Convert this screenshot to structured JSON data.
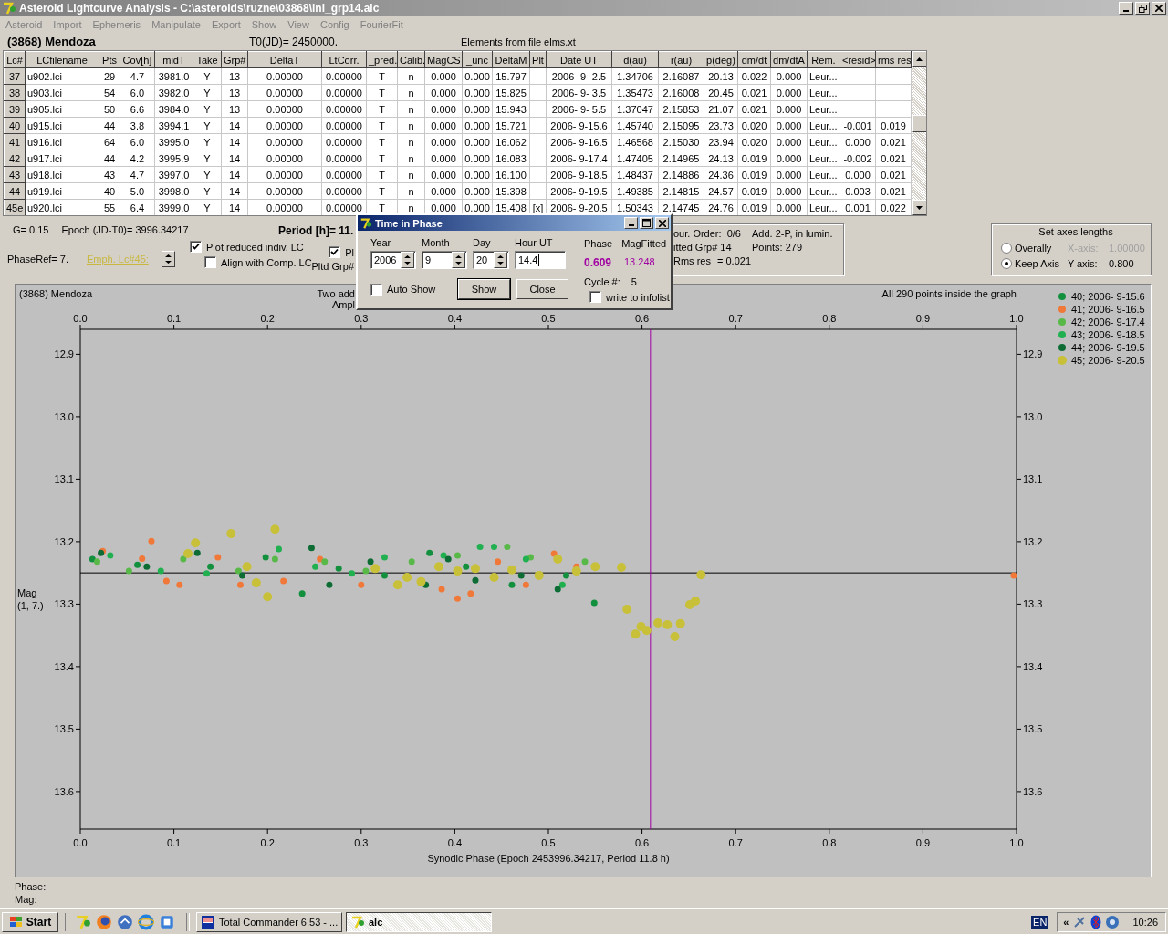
{
  "window": {
    "title": "Asteroid Lightcurve Analysis - C:\\asteroids\\ruzne\\03868\\ini_grp14.alc"
  },
  "menu": [
    {
      "label": "Asteroid",
      "disabled": true
    },
    {
      "label": "Import",
      "disabled": true
    },
    {
      "label": "Ephemeris",
      "disabled": true
    },
    {
      "label": "Manipulate",
      "disabled": true
    },
    {
      "label": "Export",
      "disabled": true
    },
    {
      "label": "Show",
      "disabled": true
    },
    {
      "label": "View",
      "disabled": true
    },
    {
      "label": "Config",
      "disabled": true
    },
    {
      "label": "FourierFit",
      "disabled": true
    }
  ],
  "header": {
    "asteroid": "(3868) Mendoza",
    "t0": "T0(JD)= 2450000.",
    "elements": "Elements from file elms.xt"
  },
  "table": {
    "columns": [
      "Lc#",
      "LCfilename",
      "Pts",
      "Cov[h]",
      "midT",
      "Take",
      "Grp#",
      "DeltaT",
      "LtCorr.",
      "_pred.",
      "Calib.",
      "MagCS",
      "_unc",
      "DeltaM",
      "Plt",
      "Date UT",
      "d(au)",
      "r(au)",
      "p(deg)",
      "dm/dt",
      "dm/dtA",
      "Rem.",
      "<resid>",
      "rms res"
    ],
    "rows": [
      {
        "cells": [
          "37",
          "u902.lci",
          "29",
          "4.7",
          "3981.0",
          "Y",
          "13",
          "0.00000",
          "0.00000",
          "T",
          "n",
          "0.000",
          "0.000",
          "15.797",
          "",
          "2006- 9- 2.5",
          "1.34706",
          "2.16087",
          "20.13",
          "0.022",
          "0.000",
          "Leur...",
          "",
          ""
        ]
      },
      {
        "cells": [
          "38",
          "u903.lci",
          "54",
          "6.0",
          "3982.0",
          "Y",
          "13",
          "0.00000",
          "0.00000",
          "T",
          "n",
          "0.000",
          "0.000",
          "15.825",
          "",
          "2006- 9- 3.5",
          "1.35473",
          "2.16008",
          "20.45",
          "0.021",
          "0.000",
          "Leur...",
          "",
          ""
        ]
      },
      {
        "cells": [
          "39",
          "u905.lci",
          "50",
          "6.6",
          "3984.0",
          "Y",
          "13",
          "0.00000",
          "0.00000",
          "T",
          "n",
          "0.000",
          "0.000",
          "15.943",
          "",
          "2006- 9- 5.5",
          "1.37047",
          "2.15853",
          "21.07",
          "0.021",
          "0.000",
          "Leur...",
          "",
          ""
        ]
      },
      {
        "cells": [
          "40",
          "u915.lci",
          "44",
          "3.8",
          "3994.1",
          "Y",
          "14",
          "0.00000",
          "0.00000",
          "T",
          "n",
          "0.000",
          "0.000",
          "15.721",
          "",
          "2006- 9-15.6",
          "1.45740",
          "2.15095",
          "23.73",
          "0.020",
          "0.000",
          "Leur...",
          "-0.001",
          "0.019"
        ]
      },
      {
        "cells": [
          "41",
          "u916.lci",
          "64",
          "6.0",
          "3995.0",
          "Y",
          "14",
          "0.00000",
          "0.00000",
          "T",
          "n",
          "0.000",
          "0.000",
          "16.062",
          "",
          "2006- 9-16.5",
          "1.46568",
          "2.15030",
          "23.94",
          "0.020",
          "0.000",
          "Leur...",
          "0.000",
          "0.021"
        ]
      },
      {
        "cells": [
          "42",
          "u917.lci",
          "44",
          "4.2",
          "3995.9",
          "Y",
          "14",
          "0.00000",
          "0.00000",
          "T",
          "n",
          "0.000",
          "0.000",
          "16.083",
          "",
          "2006- 9-17.4",
          "1.47405",
          "2.14965",
          "24.13",
          "0.019",
          "0.000",
          "Leur...",
          "-0.002",
          "0.021"
        ]
      },
      {
        "cells": [
          "43",
          "u918.lci",
          "43",
          "4.7",
          "3997.0",
          "Y",
          "14",
          "0.00000",
          "0.00000",
          "T",
          "n",
          "0.000",
          "0.000",
          "16.100",
          "",
          "2006- 9-18.5",
          "1.48437",
          "2.14886",
          "24.36",
          "0.019",
          "0.000",
          "Leur...",
          "0.000",
          "0.021"
        ]
      },
      {
        "cells": [
          "44",
          "u919.lci",
          "40",
          "5.0",
          "3998.0",
          "Y",
          "14",
          "0.00000",
          "0.00000",
          "T",
          "n",
          "0.000",
          "0.000",
          "15.398",
          "",
          "2006- 9-19.5",
          "1.49385",
          "2.14815",
          "24.57",
          "0.019",
          "0.000",
          "Leur...",
          "0.003",
          "0.021"
        ]
      },
      {
        "cells": [
          "45e",
          "u920.lci",
          "55",
          "6.4",
          "3999.0",
          "Y",
          "14",
          "0.00000",
          "0.00000",
          "T",
          "n",
          "0.000",
          "0.000",
          "15.408",
          "[x]",
          "2006- 9-20.5",
          "1.50343",
          "2.14745",
          "24.76",
          "0.019",
          "0.000",
          "Leur...",
          "0.001",
          "0.022"
        ]
      }
    ]
  },
  "controls": {
    "g": "G= 0.15",
    "epoch": "Epoch (JD-T0)= 3996.34217",
    "period": "Period [h]= 11.",
    "phase_ref": "PhaseRef= 7.",
    "emph_link": "Emph. Lc#45:",
    "checkboxes": [
      {
        "label": "Plot reduced indiv. LC",
        "checked": true
      },
      {
        "label": "Align with Comp. LC",
        "checked": false
      },
      {
        "label": "Pl",
        "checked": true
      }
    ],
    "pltd_grp": "Pltd Grp#"
  },
  "fit_box": {
    "order": "our. Order:  0/6",
    "add": "Add. 2-P, in lumin.",
    "fitted": "itted Grp# 14",
    "points": "Points: 279",
    "rms_label": "Rms res",
    "rms_value": "= 0.021"
  },
  "axes_box": {
    "title": "Set axes lengths",
    "options": [
      {
        "label": "Overally",
        "selected": false,
        "axis_label": "X-axis:",
        "axis_value": "1.00000",
        "disabled": true
      },
      {
        "label": "Keep Axis",
        "selected": true,
        "axis_label": "Y-axis:",
        "axis_value": "0.800",
        "disabled": false
      }
    ]
  },
  "dialog": {
    "title": "Time in Phase",
    "fields": [
      {
        "label": "Year",
        "value": "2006",
        "kind": "spin"
      },
      {
        "label": "Month",
        "value": "9",
        "kind": "spin"
      },
      {
        "label": "Day",
        "value": "20",
        "kind": "spin"
      },
      {
        "label": "Hour UT",
        "value": "14.4",
        "kind": "text"
      }
    ],
    "phase_label": "Phase",
    "phase": "0.609",
    "magfit_label": "MagFitted",
    "magfit": "13.248",
    "auto_show": {
      "label": "Auto Show",
      "checked": false
    },
    "buttons": [
      {
        "label": "Show",
        "default": true
      },
      {
        "label": "Close",
        "default": false
      }
    ],
    "cycle_label": "Cycle #:",
    "cycle": "5",
    "write": {
      "label": "write to infolist",
      "checked": false
    }
  },
  "plot": {
    "title": "(3868) Mendoza",
    "overlap_1": "Two add",
    "overlap_2": "Ampl",
    "points_note": "All 290 points inside the graph",
    "mag_note": "(1, 7.)",
    "series_styles": [
      {
        "emphasized": false
      },
      {
        "emphasized": false
      },
      {
        "emphasized": false
      },
      {
        "emphasized": false
      },
      {
        "emphasized": false
      },
      {
        "emphasized": true
      }
    ],
    "chart_data": {
      "type": "scatter",
      "xlabel": "Synodic Phase (Epoch 2453996.34217, Period 11.8 h)",
      "ylabel": "Mag",
      "xlim": [
        0,
        1
      ],
      "ylim": [
        13.66,
        12.86
      ],
      "xticks": [
        {
          "value": 0,
          "label": "0.0"
        },
        0.1,
        0.2,
        0.3,
        0.4,
        0.5,
        0.6,
        0.7,
        0.8,
        0.9,
        {
          "value": 1,
          "label": "1.0"
        }
      ],
      "yticks": [
        12.9,
        {
          "value": 13,
          "label": "13.0"
        },
        13.1,
        13.2,
        13.3,
        13.4,
        13.5,
        13.6
      ],
      "series": [
        {
          "name": "40; 2006- 9-15.6",
          "color": "#12903e",
          "x": [
            0.013,
            0.061,
            0.139,
            0.198,
            0.237,
            0.276,
            0.325,
            0.373,
            0.412,
            0.461,
            0.519,
            0.549
          ],
          "values": [
            13.228,
            13.237,
            13.24,
            13.225,
            13.283,
            13.243,
            13.254,
            13.218,
            13.24,
            13.269,
            13.254,
            13.298
          ]
        },
        {
          "name": "41; 2006- 9-16.5",
          "color": "#f07838",
          "x": [
            0.024,
            0.066,
            0.076,
            0.092,
            0.106,
            0.147,
            0.171,
            0.217,
            0.256,
            0.3,
            0.386,
            0.403,
            0.417,
            0.446,
            0.476,
            0.506,
            0.53,
            0.997
          ],
          "values": [
            13.215,
            13.227,
            13.199,
            13.263,
            13.269,
            13.225,
            13.269,
            13.263,
            13.228,
            13.269,
            13.276,
            13.291,
            13.283,
            13.232,
            13.269,
            13.219,
            13.24,
            13.254
          ]
        },
        {
          "name": "42; 2006- 9-17.4",
          "color": "#58b848",
          "x": [
            0.018,
            0.052,
            0.11,
            0.169,
            0.208,
            0.261,
            0.305,
            0.354,
            0.403,
            0.456,
            0.481,
            0.539
          ],
          "values": [
            13.232,
            13.247,
            13.228,
            13.247,
            13.228,
            13.232,
            13.247,
            13.232,
            13.222,
            13.208,
            13.225,
            13.232
          ]
        },
        {
          "name": "43; 2006- 9-18.5",
          "color": "#20b050",
          "x": [
            0.032,
            0.086,
            0.135,
            0.212,
            0.251,
            0.29,
            0.325,
            0.388,
            0.427,
            0.442,
            0.476,
            0.515
          ],
          "values": [
            13.222,
            13.247,
            13.251,
            13.212,
            13.24,
            13.251,
            13.225,
            13.222,
            13.208,
            13.208,
            13.228,
            13.269
          ]
        },
        {
          "name": "44; 2006- 9-19.5",
          "color": "#0c6c34",
          "x": [
            0.022,
            0.071,
            0.125,
            0.173,
            0.247,
            0.266,
            0.31,
            0.369,
            0.393,
            0.422,
            0.471,
            0.51
          ],
          "values": [
            13.218,
            13.24,
            13.218,
            13.254,
            13.21,
            13.269,
            13.232,
            13.269,
            13.228,
            13.262,
            13.254,
            13.276
          ]
        },
        {
          "name": "45; 2006- 9-20.5",
          "color": "#c8c038",
          "x": [
            0.115,
            0.123,
            0.161,
            0.208,
            0.188,
            0.2,
            0.178,
            0.315,
            0.339,
            0.349,
            0.364,
            0.383,
            0.403,
            0.422,
            0.442,
            0.461,
            0.49,
            0.51,
            0.53,
            0.55,
            0.578,
            0.584,
            0.593,
            0.599,
            0.605,
            0.617,
            0.627,
            0.635,
            0.641,
            0.651,
            0.657,
            0.663
          ],
          "values": [
            13.219,
            13.202,
            13.187,
            13.18,
            13.266,
            13.288,
            13.24,
            13.243,
            13.269,
            13.257,
            13.264,
            13.24,
            13.247,
            13.243,
            13.257,
            13.245,
            13.254,
            13.228,
            13.247,
            13.24,
            13.241,
            13.308,
            13.348,
            13.336,
            13.342,
            13.33,
            13.333,
            13.352,
            13.331,
            13.301,
            13.295,
            13.253
          ]
        }
      ],
      "ref_lines": [
        {
          "axis": "y",
          "value": 13.25,
          "color": "#000000"
        },
        {
          "axis": "x",
          "value": 0.609,
          "color": "#a000a0"
        }
      ],
      "legend": "right"
    },
    "bottom_tick_labels": [
      "0.0",
      "0.1",
      "0.2",
      "0.3",
      "0.4",
      "0.5",
      "0.6",
      "0.7",
      "0.8",
      "0.9",
      "1.0"
    ],
    "left_tick_labels": [
      "12.9",
      "13.0",
      "13.1",
      "13.2",
      "13.3",
      "13.4",
      "13.5",
      "13.6"
    ]
  },
  "status": {
    "phase_label": "Phase:",
    "mag_label": "Mag:"
  },
  "taskbar": {
    "start": "Start",
    "tasks": [
      {
        "label": "Total Commander 6.53 - ...",
        "selected": false
      },
      {
        "label": "alc",
        "selected": true
      }
    ],
    "language": "EN",
    "tray_toggle": "«",
    "clock": "10:26"
  }
}
